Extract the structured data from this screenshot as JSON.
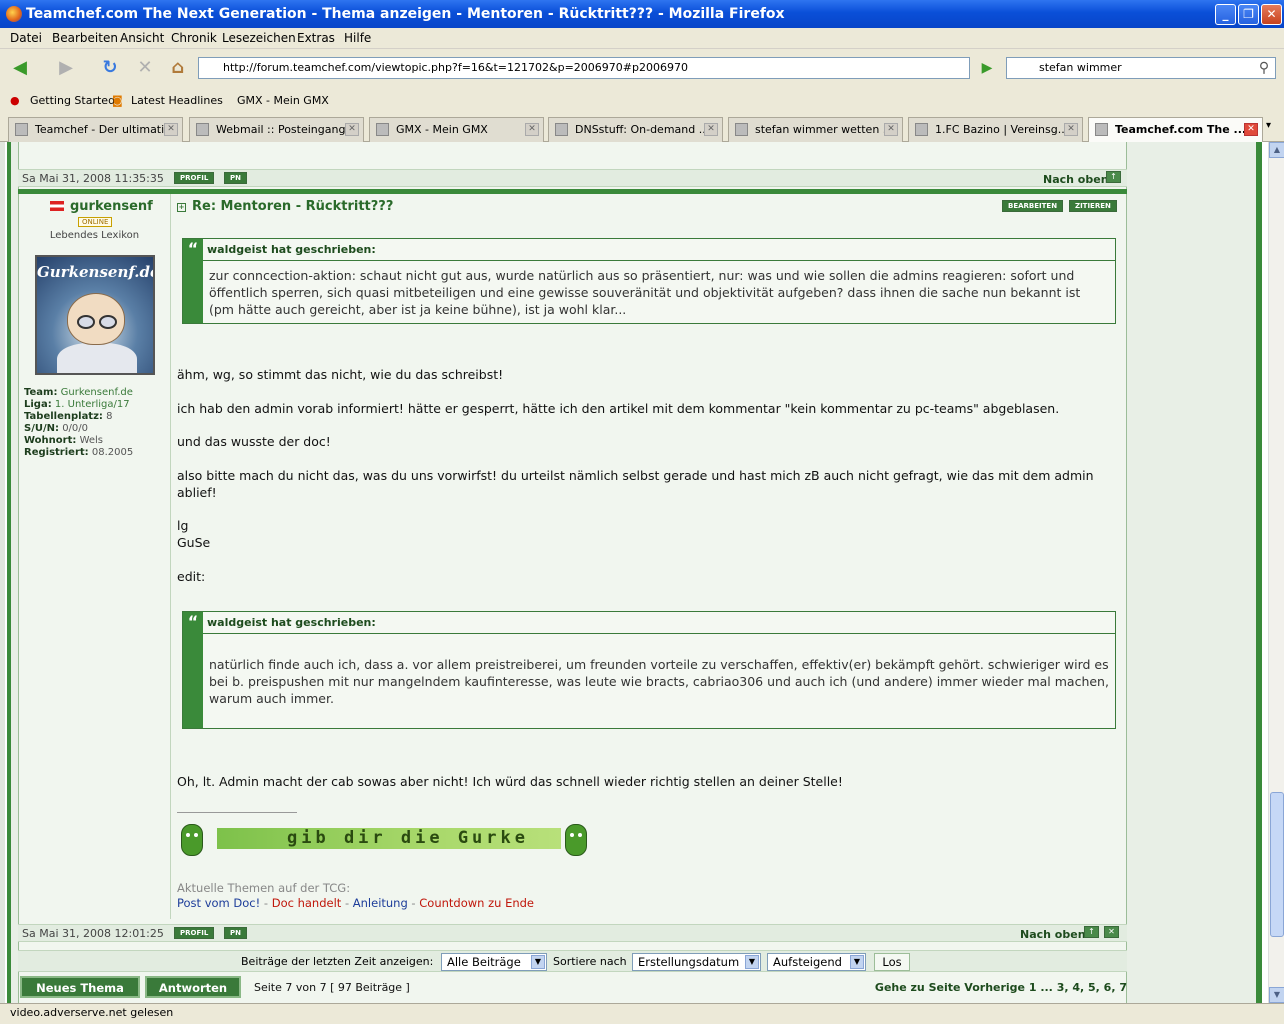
{
  "window": {
    "title": "Teamchef.com The Next Generation - Thema anzeigen - Mentoren - Rücktritt??? - Mozilla Firefox"
  },
  "menu": [
    "Datei",
    "Bearbeiten",
    "Ansicht",
    "Chronik",
    "Lesezeichen",
    "Extras",
    "Hilfe"
  ],
  "nav": {
    "url": "http://forum.teamchef.com/viewtopic.php?f=16&t=121702&p=2006970#p2006970",
    "search": "stefan wimmer"
  },
  "bookmarks": [
    "Getting Started",
    "Latest Headlines",
    "GMX - Mein GMX"
  ],
  "tabs": [
    "Teamchef - Der ultimati...",
    "Webmail :: Posteingang...",
    "GMX - Mein GMX",
    "DNSstuff: On-demand ...",
    "stefan wimmer wetten ...",
    "1.FC Bazino | Vereinsg...",
    "Teamchef.com The ..."
  ],
  "forum": {
    "prev_timestamp": "Sa Mai 31, 2008 11:35:35",
    "btn_profil": "PROFIL",
    "btn_pn": "PN",
    "nach_oben": "Nach oben",
    "btn_bearbeiten": "BEARBEITEN",
    "btn_zitieren": "ZITIEREN",
    "user": {
      "name": "gurkensenf",
      "status": "ONLINE",
      "rank": "Lebendes Lexikon",
      "avatar_text": "Gurkensenf.de",
      "info": [
        {
          "k": "Team:",
          "v": "Gurkensenf.de"
        },
        {
          "k": "Liga:",
          "v": "1. Unterliga/17"
        },
        {
          "k": "Tabellenplatz:",
          "v": "8"
        },
        {
          "k": "S/U/N:",
          "v": "0/0/0"
        },
        {
          "k": "Wohnort:",
          "v": "Wels"
        },
        {
          "k": "Registriert:",
          "v": "08.2005"
        }
      ]
    },
    "post": {
      "title": "Re: Mentoren - Rücktritt???",
      "quote1_head": "waldgeist hat geschrieben:",
      "quote1_l1": "zur conncection-aktion: schaut nicht gut aus, wurde natürlich aus so präsentiert, nur: was und wie sollen die admins reagieren: sofort und",
      "quote1_l2": "öffentlich sperren, sich quasi mitbeteiligen und eine gewisse souveränität und objektivität aufgeben? dass ihnen die sache nun bekannt ist",
      "quote1_l3": "(pm hätte auch gereicht, aber ist ja keine bühne), ist ja wohl klar...",
      "p1": "ähm, wg, so stimmt das nicht, wie du das schreibst!",
      "p2": "ich hab den admin vorab informiert! hätte er gesperrt, hätte ich den artikel mit dem kommentar \"kein kommentar zu pc-teams\" abgeblasen.",
      "p3": "und das wusste der doc!",
      "p4a": "also bitte mach du nicht das, was du uns vorwirfst! du urteilst nämlich selbst gerade und hast mich zB auch nicht gefragt, wie das mit dem admin",
      "p4b": "ablief!",
      "p5a": "lg",
      "p5b": "GuSe",
      "p6": "edit:",
      "quote2_head": "waldgeist hat geschrieben:",
      "quote2_l1": "natürlich finde auch ich, dass a. vor allem preistreiberei, um freunden vorteile zu verschaffen, effektiv(er) bekämpft gehört. schwieriger wird es",
      "quote2_l2": "bei b. preispushen mit nur mangelndem kaufinteresse, was leute wie bracts, cabriao306 und auch ich (und andere) immer wieder mal machen,",
      "quote2_l3": "warum auch immer.",
      "p7": "Oh, lt. Admin macht der cab sowas aber nicht! Ich würd das schnell wieder richtig stellen an deiner Stelle!",
      "banner": "gib dir die Gurke",
      "sig_text": "Aktuelle Themen auf der TCG:",
      "sig_links": [
        "Post vom Doc!",
        "Doc handelt",
        "Anleitung",
        "Countdown zu Ende"
      ],
      "timestamp": "Sa Mai 31, 2008 12:01:25"
    },
    "filter": {
      "label1": "Beiträge der letzten Zeit anzeigen:",
      "sel1": "Alle Beiträge",
      "label2": "Sortiere nach",
      "sel2": "Erstellungsdatum",
      "sel3": "Aufsteigend",
      "go": "Los"
    },
    "bottom": {
      "new_topic": "Neues Thema",
      "reply": "Antworten",
      "page_info": "Seite 7 von 7  [ 97 Beiträge ]",
      "page_nav": "Gehe zu Seite Vorherige  1 ... 3, 4, 5, 6, 7"
    }
  },
  "status": "video.adverserve.net gelesen"
}
